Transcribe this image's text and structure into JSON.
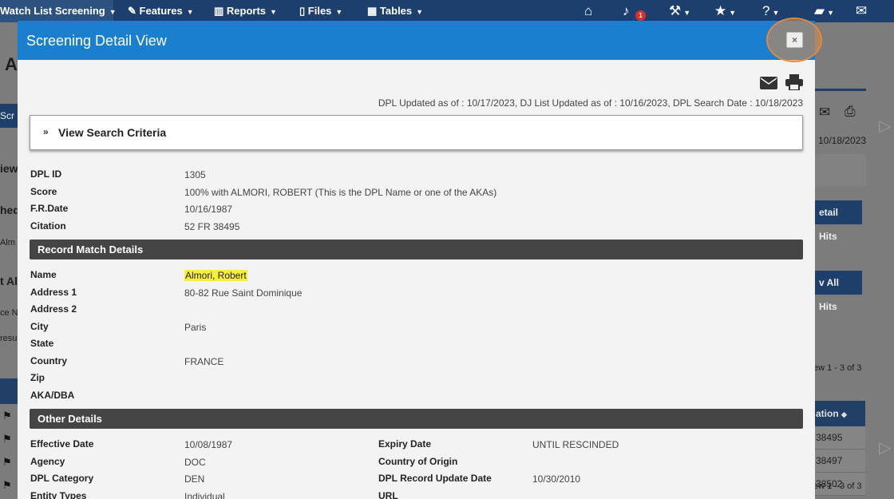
{
  "topnav": {
    "items": [
      {
        "label": "Watch List Screening"
      },
      {
        "label": "Features"
      },
      {
        "label": "Reports"
      },
      {
        "label": "Files"
      },
      {
        "label": "Tables"
      }
    ],
    "notification_count": "1"
  },
  "background": {
    "fragments": [
      "A",
      "Scr",
      "iew",
      "hed",
      "Alm",
      "t Al",
      "ce N",
      "resu"
    ],
    "date": "10/18/2023",
    "detail_hits_label": "etail Hits",
    "view_all_hits_label": "v All Hits",
    "view_count_top": "ew 1 - 3 of 3",
    "view_count_bottom": "ew 1 - 3 of 3",
    "column_header": "ation",
    "cells": [
      "38495",
      "38497",
      "38502"
    ]
  },
  "modal": {
    "title": "Screening Detail View",
    "close_label": "×",
    "updated_line": "DPL Updated as of : 10/17/2023,  DJ List Updated as of : 10/16/2023,  DPL Search Date : 10/18/2023",
    "criteria_label": "View Search Criteria",
    "summary": [
      {
        "label": "DPL ID",
        "value": "1305"
      },
      {
        "label": "Score",
        "value": "100% with ALMORI, ROBERT (This is the DPL Name or one of the AKAs)"
      },
      {
        "label": "F.R.Date",
        "value": "10/16/1987"
      },
      {
        "label": "Citation",
        "value": "52 FR 38495"
      }
    ],
    "record_section_title": "Record Match Details",
    "record": [
      {
        "label": "Name",
        "value": "Almori, Robert"
      },
      {
        "label": "Address 1",
        "value": "80-82 Rue Saint Dominique"
      },
      {
        "label": "Address 2",
        "value": ""
      },
      {
        "label": "City",
        "value": "Paris"
      },
      {
        "label": "State",
        "value": ""
      },
      {
        "label": "Country",
        "value": "FRANCE"
      },
      {
        "label": "Zip",
        "value": ""
      },
      {
        "label": "AKA/DBA",
        "value": ""
      }
    ],
    "other_section_title": "Other Details",
    "other_left": [
      {
        "label": "Effective Date",
        "value": "10/08/1987"
      },
      {
        "label": "Agency",
        "value": "DOC"
      },
      {
        "label": "DPL Category",
        "value": "DEN"
      },
      {
        "label": "Entity Types",
        "value": "Individual"
      }
    ],
    "other_right": [
      {
        "label": "Expiry Date",
        "value": "UNTIL RESCINDED"
      },
      {
        "label": "Country of Origin",
        "value": ""
      },
      {
        "label": "DPL Record Update Date",
        "value": "10/30/2010"
      },
      {
        "label": "URL",
        "value": ""
      }
    ]
  },
  "colors": {
    "nav": "#1d3f6e",
    "modal_header": "#1a7fcf",
    "section_bar": "#454545",
    "highlight": "#f6f03c",
    "close_ring": "#e08c46"
  }
}
